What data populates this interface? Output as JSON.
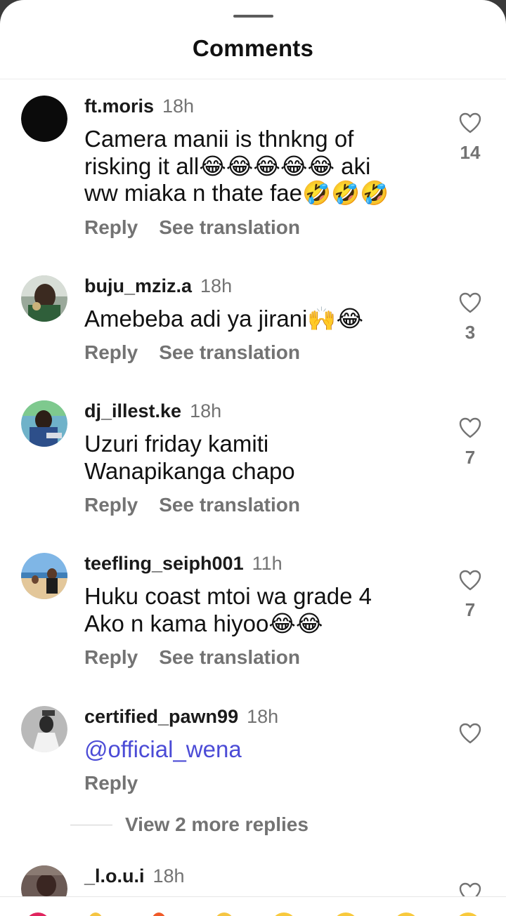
{
  "sheet": {
    "title": "Comments"
  },
  "comments": [
    {
      "username": "ft.moris",
      "time": "18h",
      "lines": [
        "Camera manii is thnkng of",
        "risking it all😂😂😂😂😂 aki",
        "ww  miaka n thate fae🤣🤣🤣"
      ],
      "likes": "14",
      "reply_label": "Reply",
      "translate_label": "See translation"
    },
    {
      "username": "buju_mziz.a",
      "time": "18h",
      "lines": [
        "Amebeba adi ya jirani🙌😂"
      ],
      "likes": "3",
      "reply_label": "Reply",
      "translate_label": "See translation"
    },
    {
      "username": "dj_illest.ke",
      "time": "18h",
      "lines": [
        "Uzuri friday kamiti",
        "Wanapikanga chapo"
      ],
      "likes": "7",
      "reply_label": "Reply",
      "translate_label": "See translation"
    },
    {
      "username": "teefling_seiph001",
      "time": "11h",
      "lines": [
        "Huku coast mtoi wa grade 4",
        "Ako n kama hiyoo😂😂"
      ],
      "likes": "7",
      "reply_label": "Reply",
      "translate_label": "See translation"
    },
    {
      "username": "certified_pawn99",
      "time": "18h",
      "mention": "@official_wena",
      "likes": "",
      "reply_label": "Reply",
      "more_replies_label": "View 2 more replies"
    },
    {
      "username": "_l.o.u.i",
      "time": "18h"
    }
  ],
  "icons": {
    "like": "heart-icon"
  },
  "colors": {
    "mention": "#4b4bd6",
    "secondary_text": "#737373"
  }
}
